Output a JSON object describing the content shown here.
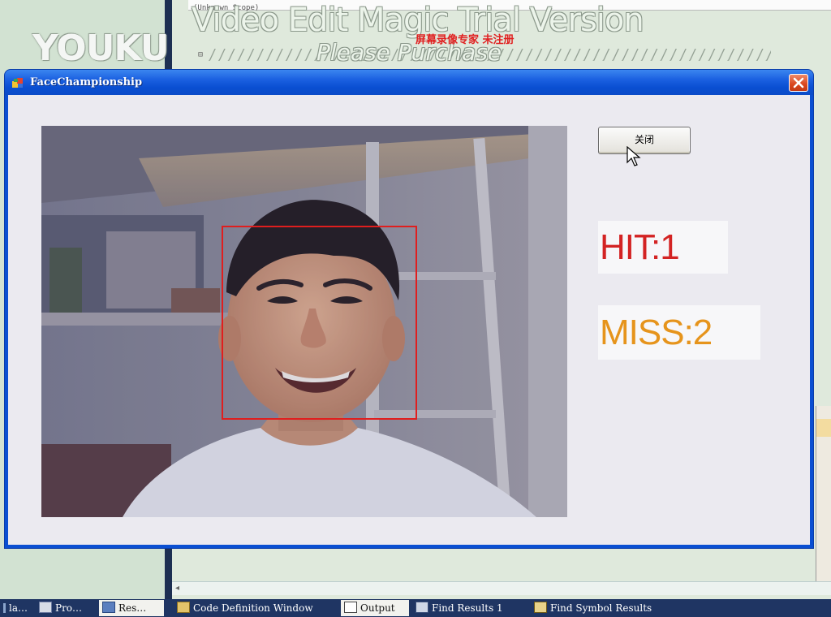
{
  "watermark": {
    "brand": "YOUKU",
    "editor_title": "Video Edit Magic Trial Version",
    "purchase": "Please Purchase",
    "red_text": "屏幕录像专家 未注册",
    "slashes": "//////////////////////////////////////////////////////////////////////////////////////////"
  },
  "ide": {
    "editor_crumb": "(Unknown Scope)",
    "gutter_mark": "⊟"
  },
  "window": {
    "title": "FaceChampionship",
    "close_button_label": "关闭",
    "hit_text": "HIT:1",
    "miss_text": "MISS:2"
  },
  "taskbar": {
    "tabs": [
      {
        "label": "la…",
        "icon": "list-icon"
      },
      {
        "label": "Pro…",
        "icon": "properties-icon"
      },
      {
        "label": "Res…",
        "icon": "resource-icon",
        "active": true
      },
      {
        "label": "Code Definition Window",
        "icon": "code-definition-icon"
      },
      {
        "label": "Output",
        "icon": "output-icon",
        "active": true
      },
      {
        "label": "Find Results 1",
        "icon": "find-results-icon"
      },
      {
        "label": "Find Symbol Results",
        "icon": "find-symbol-icon"
      }
    ]
  },
  "colors": {
    "hit": "#d32323",
    "miss": "#e6941c",
    "face_box": "#e01e1e",
    "titlebar": "#0a4fd2"
  }
}
